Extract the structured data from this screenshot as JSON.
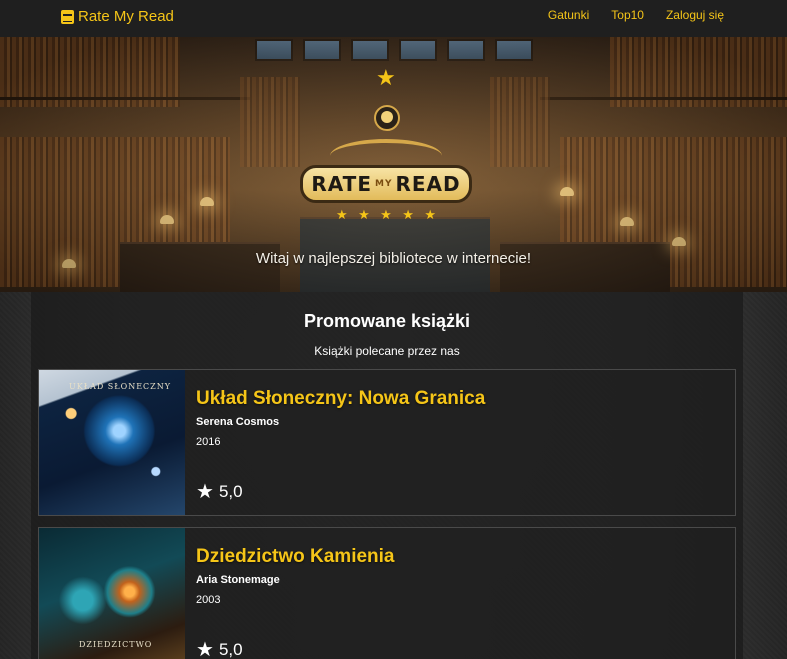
{
  "navbar": {
    "brand": "Rate My Read",
    "links": [
      "Gatunki",
      "Top10",
      "Zaloguj się"
    ]
  },
  "hero": {
    "logo_word_1": "RATE",
    "logo_word_2": "MY",
    "logo_word_3": "READ",
    "tagline": "Witaj w najlepszej bibliotece w internecie!"
  },
  "section": {
    "title": "Promowane książki",
    "subtitle": "Książki polecane przez nas"
  },
  "books": [
    {
      "title": "Układ Słoneczny: Nowa Granica",
      "author": "Serena Cosmos",
      "year": "2016",
      "rating": "5,0",
      "cover_text": "UKŁAD SŁONECZNY"
    },
    {
      "title": "Dziedzictwo Kamienia",
      "author": "Aria Stonemage",
      "year": "2003",
      "rating": "5,0",
      "cover_text": "DZIEDZICTWO"
    }
  ],
  "colors": {
    "accent": "#f5c518",
    "navbar_bg": "#1f1f1f",
    "panel_bg": "#1c1c1c"
  },
  "icons": {
    "brand": "book-icon",
    "rating": "star-icon"
  }
}
